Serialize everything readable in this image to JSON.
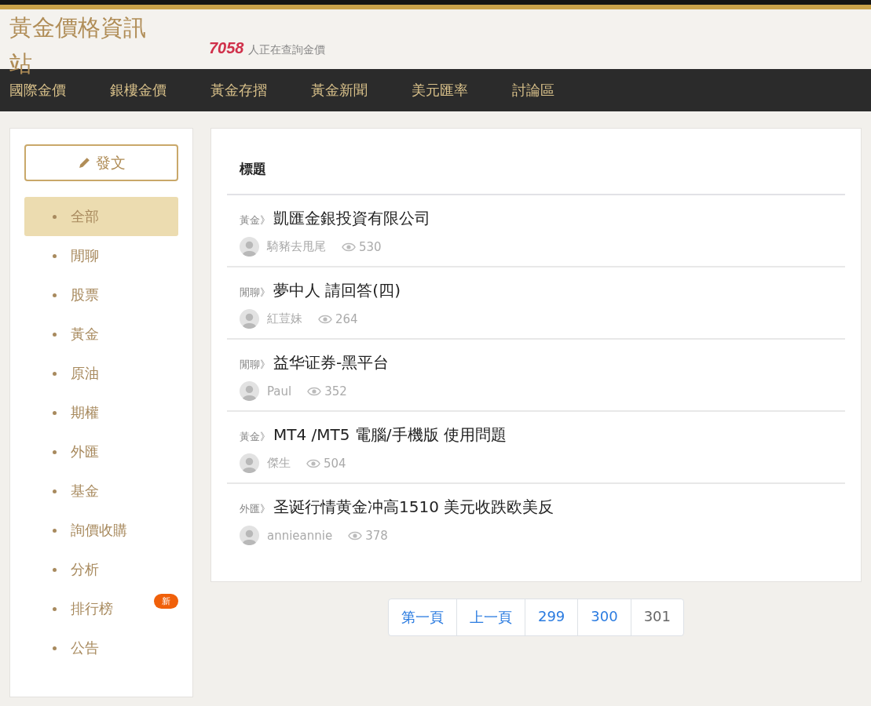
{
  "site": {
    "title": "黃金價格資訊站",
    "online_count": "7058",
    "online_text": "人正在查詢金價"
  },
  "nav": [
    "國際金價",
    "銀樓金價",
    "黃金存摺",
    "黃金新聞",
    "美元匯率",
    "討論區"
  ],
  "post_button": {
    "label": "發文"
  },
  "categories": [
    {
      "label": "全部",
      "selected": true
    },
    {
      "label": "閒聊",
      "selected": false
    },
    {
      "label": "股票",
      "selected": false
    },
    {
      "label": "黃金",
      "selected": false
    },
    {
      "label": "原油",
      "selected": false
    },
    {
      "label": "期權",
      "selected": false
    },
    {
      "label": "外匯",
      "selected": false
    },
    {
      "label": "基金",
      "selected": false
    },
    {
      "label": "詢價收購",
      "selected": false
    },
    {
      "label": "分析",
      "selected": false
    },
    {
      "label": "排行榜",
      "selected": false,
      "badge": "新"
    },
    {
      "label": "公告",
      "selected": false
    }
  ],
  "table": {
    "heading": "標題",
    "rows": [
      {
        "category": "黃金》",
        "title": "凱匯金銀投資有限公司",
        "author": "騎豬去甩尾",
        "views": "530"
      },
      {
        "category": "閒聊》",
        "title": "夢中人 請回答(四)",
        "author": "紅荳妹",
        "views": "264"
      },
      {
        "category": "閒聊》",
        "title": "益华证券-黑平台",
        "author": "Paul",
        "views": "352"
      },
      {
        "category": "黃金》",
        "title": "MT4 /MT5 電腦/手機版 使用問題",
        "author": "傑生",
        "views": "504"
      },
      {
        "category": "外匯》",
        "title": "圣诞行情黄金冲高1510 美元收跌欧美反",
        "author": "annieannie",
        "views": "378"
      }
    ]
  },
  "pagination": [
    {
      "label": "第一頁",
      "selected": false
    },
    {
      "label": "上一頁",
      "selected": false
    },
    {
      "label": "299",
      "selected": false
    },
    {
      "label": "300",
      "selected": false
    },
    {
      "label": "301",
      "selected": true
    }
  ]
}
